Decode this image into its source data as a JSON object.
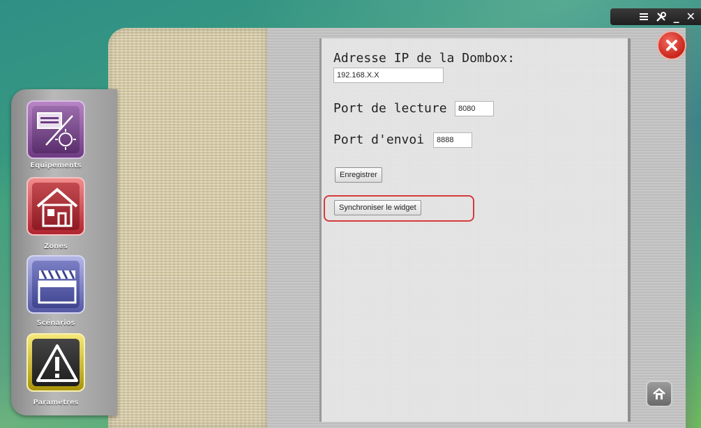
{
  "titlebar": {
    "menu_icon": "menu-icon",
    "tools_icon": "tools-icon",
    "minimize_label": "_",
    "close_label": "✕"
  },
  "nav": {
    "items": [
      {
        "label": "Equipements",
        "icon": "equipment-icon",
        "accent": "#8a4aa0"
      },
      {
        "label": "Zones",
        "icon": "house-icon",
        "accent": "#c0313c"
      },
      {
        "label": "Scénarios",
        "icon": "clapperboard-icon",
        "accent": "#5a5fb0"
      },
      {
        "label": "Paramètres",
        "icon": "warning-icon",
        "accent": "#c9b30f"
      }
    ]
  },
  "form": {
    "ip_label": "Adresse IP de la Dombox:",
    "ip_value": "192.168.X.X",
    "read_port_label": "Port de lecture :",
    "read_port_value": "8080",
    "send_port_label": "Port d'envoi :",
    "send_port_value": "8888",
    "save_button": "Enregistrer",
    "sync_button": "Synchroniser le widget"
  },
  "colors": {
    "highlight": "#d43a3a",
    "close_button": "#d63a2e"
  }
}
